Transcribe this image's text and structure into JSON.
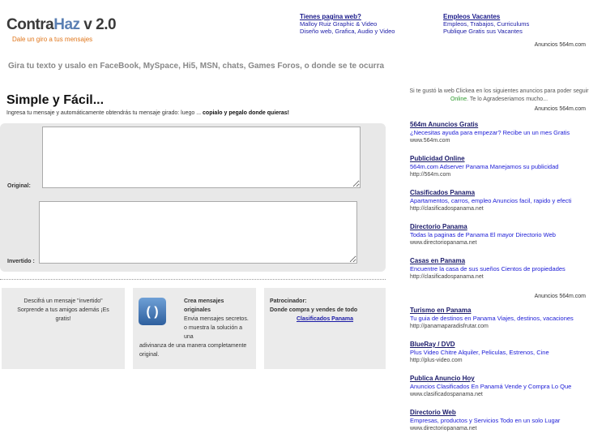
{
  "logo": {
    "part1": "Contra",
    "part2": "Haz",
    "part3": " v 2.0"
  },
  "tagline": "Dale un giro a tus mensajes",
  "top_ads": [
    {
      "title": "Tienes pagina web?",
      "desc": [
        "Malloy Ruiz Graphic & Video",
        "Diseño web, Grafica, Audio y Video"
      ]
    },
    {
      "title": "Empleos Vacantes",
      "desc": [
        "Empleos, Trabajos, Curriculums",
        "Publique Gratis sus Vacantes"
      ]
    }
  ],
  "ads_by_label": "Anuncios 564m.com",
  "subtitle": "Gira tu texto y usalo en FaceBook, MySpace, Hi5, MSN, chats, Games Foros, o donde se te ocurra",
  "main": {
    "title": "Simple y Fácil...",
    "instructions_prefix": "Ingresa tu mensaje y automáticamente obtendrás tu mensaje girado: luego ... ",
    "instructions_bold": "copialo y pegalo donde quieras!",
    "original_label": "Original:",
    "inverted_label": "Invertido :"
  },
  "boxes": {
    "box1": "Descifrá un mensaje \"invertido\" Sorprende a tus amigos además ¡Es gratis!",
    "box2_title": "Crea mensajes originales",
    "box2_text1": "Envia mensajes secretos. o muestra la solución a una",
    "box2_text2": "adivinanza de una manera completamente original.",
    "app_icon_glyph": "( )",
    "box3_title": "Patrocinador:",
    "box3_text": "Donde compra y vendes de todo",
    "box3_link": "Clasificados Panama"
  },
  "side": {
    "intro_prefix": "Si te gustó la web Clickea en los siguientes anuncios para poder seguir ",
    "intro_online": "Online",
    "intro_suffix": ". Te lo Agradeseriamos mucho...",
    "ads_block1": [
      {
        "title": "564m Anuncios Gratis",
        "desc": "¿Necesitas ayuda para empezar? Recibe un un mes Gratis",
        "url": "www.564m.com"
      },
      {
        "title": "Publicidad Online",
        "desc": "564m.com Adserver Panama Manejamos su publicidad",
        "url": "http://564m.com"
      },
      {
        "title": "Clasificados Panama",
        "desc": "Apartamentos, carros, empleo Anuncios facil, rapido y efecti",
        "url": "http://clasificadospanama.net"
      },
      {
        "title": "Directorio Panama",
        "desc": "Todas la paginas de Panama El mayor Directorio Web",
        "url": "www.directoriopanama.net"
      },
      {
        "title": "Casas en Panama",
        "desc": "Encuentre la casa de sus sueños Cientos de propiedades",
        "url": "http://clasificadospanama.net"
      }
    ],
    "ads_block2": [
      {
        "title": "Turismo en Panama",
        "desc": "Tu guia de destinos en Panama Viajes, destinos, vacaciones",
        "url": "http://panamaparadisfrutar.com"
      },
      {
        "title": "BlueRay / DVD",
        "desc": "Plus Video Chitre Alquiler, Peliculas, Estrenos, Cine",
        "url": "http://plus-video.com"
      },
      {
        "title": "Publica Anuncio Hoy",
        "desc": "Anuncios Clasificados En Panamá Vende y Compra Lo Que",
        "url": "www.clasificadospanama.net"
      },
      {
        "title": "Directorio Web",
        "desc": "Empresas, productos y Servicios Todo en un solo Lugar",
        "url": "www.directoriopanama.net"
      }
    ]
  }
}
